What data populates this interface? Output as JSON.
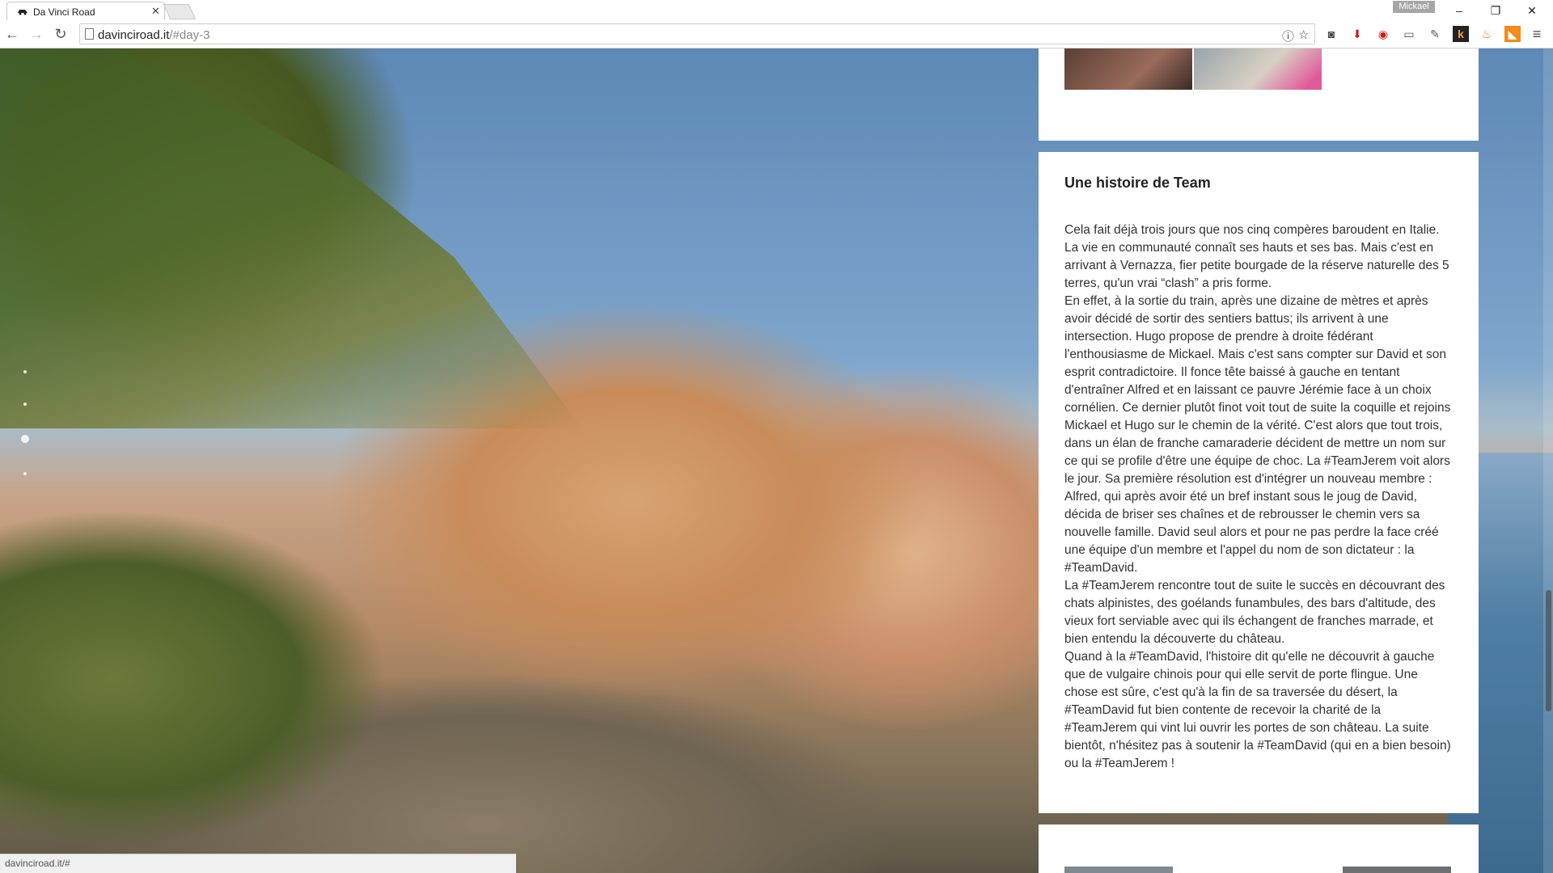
{
  "browser": {
    "tab_title": "Da Vinci Road",
    "user_name": "Mickael",
    "url_host": "davinciroad.it",
    "url_path": "/#day-3",
    "status_url": "davinciroad.it/#"
  },
  "article": {
    "title": "Une histoire de Team",
    "paragraphs": [
      "Cela fait déjà trois jours que nos cinq compères baroudent en Italie. La vie en communauté connaît ses hauts et ses bas. Mais c'est en arrivant à Vernazza, fier petite bourgade de la réserve naturelle des 5 terres, qu'un vrai “clash” a pris forme.",
      "En effet, à la sortie du train, après une dizaine de mètres et après avoir décidé de sortir des sentiers battus; ils arrivent à une intersection. Hugo propose de prendre à droite fédérant l'enthousiasme de Mickael. Mais c'est sans compter sur David et son esprit contradictoire. Il fonce tête baissé à gauche en tentant d'entraîner Alfred et en laissant ce pauvre Jérémie face à un choix cornélien. Ce dernier plutôt finot voit tout de suite la coquille et rejoins Mickael et Hugo sur le chemin de la vérité. C'est alors que tout trois, dans un élan de franche camaraderie décident de mettre un nom sur ce qui se profile d'être une équipe de choc. La #TeamJerem voit alors le jour. Sa première résolution est d'intégrer un nouveau membre : Alfred, qui après avoir été un bref instant sous le joug de David, décida de briser ses chaînes et de rebrousser le chemin vers sa nouvelle famille. David seul alors et pour ne pas perdre la face créé une équipe d'un membre et l'appel du nom de son dictateur : la #TeamDavid.",
      "La #TeamJerem rencontre tout de suite le succès en découvrant des chats alpinistes, des goélands funambules, des bars d'altitude, des vieux fort serviable avec qui ils échangent de franches marrade, et bien entendu la découverte du château.",
      "Quand à la #TeamDavid, l'histoire dit qu'elle ne découvrit à gauche que de vulgaire chinois pour qui elle servit de porte flingue. Une chose est sûre, c'est qu'à la fin de sa traversée du désert, la #TeamDavid fut bien contente de recevoir la charité de la #TeamJerem qui vint lui ouvrir les portes de son château. La suite bientôt, n'hésitez pas à soutenir la #TeamDavid (qui en a bien besoin) ou la #TeamJerem !"
    ]
  },
  "colors": {
    "accent_opera": "#cc1b1b",
    "accent_pocket": "#444444"
  },
  "icons": [
    "back-arrow-icon",
    "forward-arrow-icon",
    "reload-icon",
    "page-icon",
    "info-icon",
    "star-icon",
    "pocket-icon",
    "download-icon",
    "opera-icon",
    "cast-icon",
    "eyedropper-icon",
    "k-extension-icon",
    "fire-icon",
    "rss-icon",
    "menu-icon"
  ]
}
